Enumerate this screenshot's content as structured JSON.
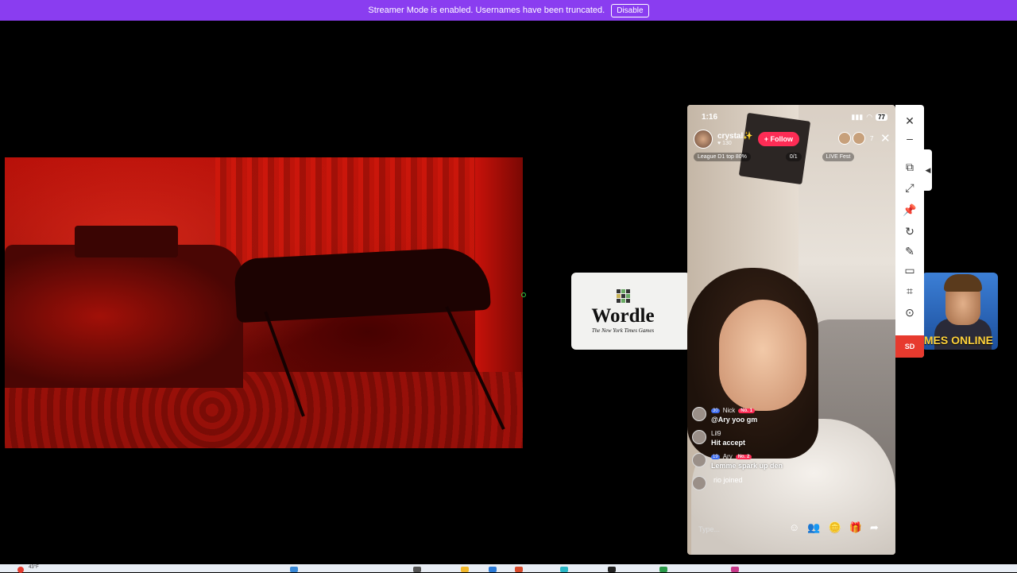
{
  "banner": {
    "text": "Streamer Mode is enabled. Usernames have been truncated.",
    "disable_label": "Disable"
  },
  "wordle": {
    "title": "Wordle",
    "subtitle": "The New York Times Games"
  },
  "games": {
    "text": "MES ONLINE"
  },
  "phone": {
    "time": "1:16",
    "battery": "77",
    "streamer_name": "crystal✨",
    "likes": "♥ 130",
    "follow_label": "+ Follow",
    "viewer_count": "7",
    "league": "League D1 top 80%",
    "progress": "0/1",
    "fest": "LIVE Fest",
    "chat": [
      {
        "user": "Nick",
        "level": "30",
        "rank": "No. 1",
        "text": "@Ary yoo gm"
      },
      {
        "user": "Lil9",
        "level": "",
        "rank": "",
        "text": "Hit accept"
      },
      {
        "user": "Ary",
        "level": "19",
        "rank": "No. 2",
        "text": "Lemme spark up den"
      }
    ],
    "joined": "rio joined",
    "input_placeholder": "Type..."
  },
  "toolbar": {
    "sd_label": "SD"
  },
  "taskbar": {
    "text": "43°F"
  },
  "colors": {
    "banner": "#8a3df0",
    "follow": "#fe2c55",
    "sd": "#e73a2e"
  },
  "icons": [
    "close-icon",
    "minimize-icon",
    "picture-in-picture-icon",
    "expand-icon",
    "pin-icon",
    "rotate-icon",
    "pen-icon",
    "sidebar-icon",
    "crop-icon",
    "record-icon",
    "chevron-left-icon",
    "emoji-icon",
    "people-icon",
    "coin-icon",
    "gift-icon",
    "share-icon"
  ]
}
